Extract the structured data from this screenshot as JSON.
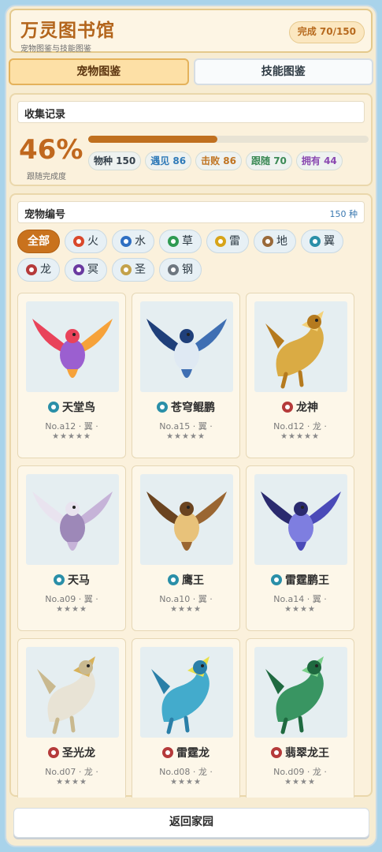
{
  "header": {
    "title": "万灵图书馆",
    "subtitle": "宠物图鉴与技能图鉴",
    "progress": "完成 70/150"
  },
  "tabs": [
    {
      "label": "宠物图鉴",
      "active": true
    },
    {
      "label": "技能图鉴",
      "active": false
    }
  ],
  "collection": {
    "heading": "收集记录",
    "percent": "46%",
    "percent_label": "跟随完成度",
    "bar_fraction": 0.46,
    "stats": [
      "物种 150",
      "遇见 86",
      "击败 86",
      "跟随 70",
      "拥有 44"
    ]
  },
  "catalog": {
    "heading": "宠物编号",
    "count": "150 种",
    "filters": [
      {
        "label": "全部",
        "icon": "",
        "color": ""
      },
      {
        "label": "火",
        "icon": "fire-icon",
        "color": "#d9482b"
      },
      {
        "label": "水",
        "icon": "water-icon",
        "color": "#2f6fc2"
      },
      {
        "label": "草",
        "icon": "leaf-icon",
        "color": "#2f9a52"
      },
      {
        "label": "雷",
        "icon": "lightning-icon",
        "color": "#d7a41a"
      },
      {
        "label": "地",
        "icon": "earth-icon",
        "color": "#9a6a3a"
      },
      {
        "label": "翼",
        "icon": "wing-icon",
        "color": "#2a8fa8"
      },
      {
        "label": "龙",
        "icon": "dragon-icon",
        "color": "#b53a3a"
      },
      {
        "label": "冥",
        "icon": "moon-icon",
        "color": "#6a3aa0"
      },
      {
        "label": "圣",
        "icon": "holy-icon",
        "color": "#c4a24a"
      },
      {
        "label": "钢",
        "icon": "steel-icon",
        "color": "#6e7780"
      }
    ],
    "pets": [
      {
        "name": "天堂鸟",
        "meta": "No.a12 · 翼 ·",
        "stars": "★★★★★",
        "element_color": "#2a8fa8",
        "art": "rainbow-phoenix",
        "colors": [
          "#e9435a",
          "#f6a23a",
          "#f2d94b",
          "#5ec46d",
          "#4a8fe0",
          "#9b5fd0"
        ]
      },
      {
        "name": "苍穹鲲鹏",
        "meta": "No.a15 · 翼 ·",
        "stars": "★★★★★",
        "element_color": "#2a8fa8",
        "art": "sky-whale",
        "colors": [
          "#1f3f7a",
          "#3f6fb3",
          "#dfe9f3"
        ]
      },
      {
        "name": "龙神",
        "meta": "No.d12 · 龙 ·",
        "stars": "★★★★★",
        "element_color": "#b53a3a",
        "art": "golden-dragon",
        "colors": [
          "#d9a63a",
          "#b57a1e",
          "#f4d27a"
        ]
      },
      {
        "name": "天马",
        "meta": "No.a09 · 翼 ·",
        "stars": "★★★★",
        "element_color": "#2a8fa8",
        "art": "pegasus",
        "colors": [
          "#e9e3ef",
          "#c6b3d8",
          "#9d88b8"
        ]
      },
      {
        "name": "鹰王",
        "meta": "No.a10 · 翼 ·",
        "stars": "★★★★",
        "element_color": "#2a8fa8",
        "art": "eagle-king",
        "colors": [
          "#6b4420",
          "#9a6632",
          "#e8c27a"
        ]
      },
      {
        "name": "雷霆鹏王",
        "meta": "No.a14 · 翼 ·",
        "stars": "★★★★",
        "element_color": "#2a8fa8",
        "art": "thunder-roc",
        "colors": [
          "#2a2a6e",
          "#4a4ab8",
          "#7e7ee0"
        ]
      },
      {
        "name": "圣光龙",
        "meta": "No.d07 · 龙 ·",
        "stars": "★★★★",
        "element_color": "#b53a3a",
        "art": "holy-dragon",
        "colors": [
          "#e8e1d3",
          "#c9b98f",
          "#d8b25a"
        ]
      },
      {
        "name": "雷霆龙",
        "meta": "No.d08 · 龙 ·",
        "stars": "★★★★",
        "element_color": "#b53a3a",
        "art": "thunder-dragon",
        "colors": [
          "#3aa6c9",
          "#2a7fa8",
          "#e9e04a"
        ]
      },
      {
        "name": "翡翠龙王",
        "meta": "No.d09 · 龙 ·",
        "stars": "★★★★",
        "element_color": "#b53a3a",
        "art": "emerald-dragon",
        "colors": [
          "#2f8f5a",
          "#1f6a40",
          "#7ad08a"
        ]
      }
    ]
  },
  "footer": {
    "button": "返回家园"
  }
}
